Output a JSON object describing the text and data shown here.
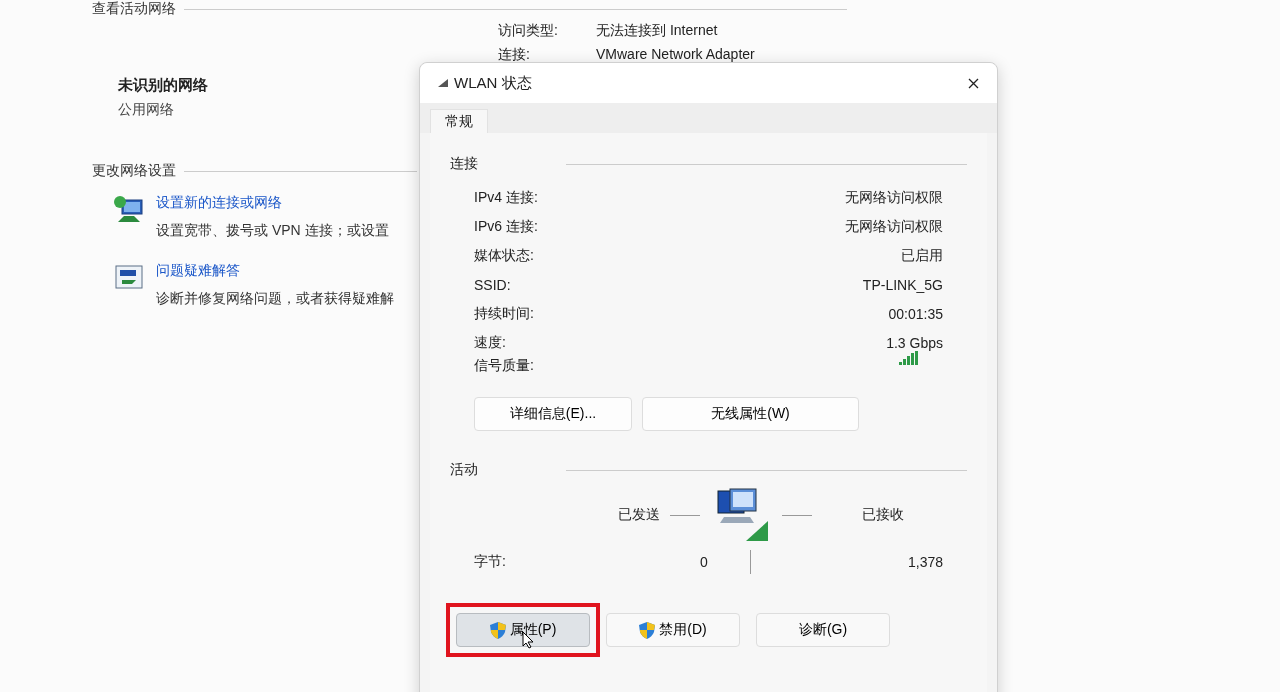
{
  "background": {
    "section_title": "查看活动网络",
    "network_name": "未识别的网络",
    "network_type": "公用网络",
    "access": [
      {
        "label": "访问类型:",
        "value": "无法连接到 Internet"
      },
      {
        "label": "连接:",
        "value": "VMware Network Adapter"
      }
    ],
    "settings_title": "更改网络设置",
    "tasks": [
      {
        "kind": "new-connection",
        "link": "设置新的连接或网络",
        "description": "设置宽带、拨号或 VPN 连接；或设置"
      },
      {
        "kind": "troubleshoot",
        "link": "问题疑难解答",
        "description": "诊断并修复网络问题，或者获得疑难解"
      }
    ]
  },
  "dialog": {
    "title": "WLAN 状态",
    "tabs": [
      {
        "label": "常规",
        "selected": true
      }
    ],
    "connection": {
      "title": "连接",
      "rows": [
        {
          "label": "IPv4 连接:",
          "value": "无网络访问权限"
        },
        {
          "label": "IPv6 连接:",
          "value": "无网络访问权限"
        },
        {
          "label": "媒体状态:",
          "value": "已启用"
        },
        {
          "label": "SSID:",
          "value": "TP-LINK_5G"
        },
        {
          "label": "持续时间:",
          "value": "00:01:35"
        },
        {
          "label": "速度:",
          "value": "1.3 Gbps"
        }
      ],
      "signal_label": "信号质量:",
      "buttons": [
        "详细信息(E)...",
        "无线属性(W)"
      ]
    },
    "activity": {
      "title": "活动",
      "sent_label": "已发送",
      "received_label": "已接收",
      "bytes_label": "字节:",
      "sent": "0",
      "received": "1,378"
    },
    "buttons": [
      {
        "label": "属性(P)",
        "shield": true,
        "highlighted": true
      },
      {
        "label": "禁用(D)",
        "shield": true,
        "highlighted": false
      },
      {
        "label": "诊断(G)",
        "shield": false,
        "highlighted": false
      }
    ]
  }
}
